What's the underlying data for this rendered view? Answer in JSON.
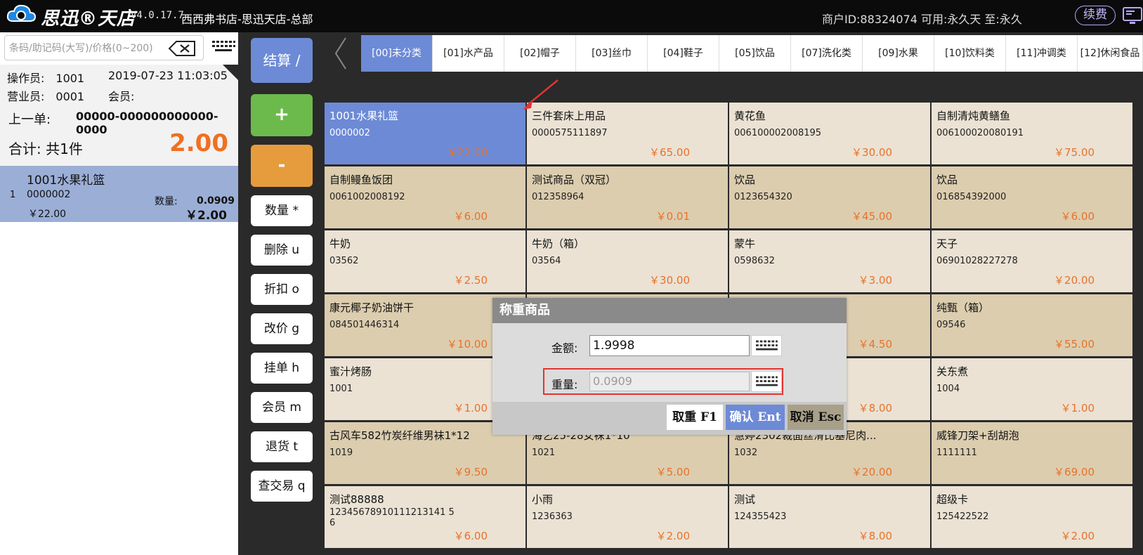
{
  "header": {
    "brand": "思迅®天店",
    "version": "V4.0.17.7",
    "store": "西西弗书店-思迅天店-总部",
    "merchant": "商户ID:88324074 可用:永久天 至:永久",
    "renew": "续费"
  },
  "search": {
    "placeholder": "条码/助记码(大写)/价格(0~200)"
  },
  "info": {
    "operator": "操作员:　1001",
    "datetime": "2019-07-23 11:03:05",
    "clerk": "营业员:　0001",
    "member": "会员:",
    "last_order_label": "上一单:",
    "last_order_value": "00000-000000000000-0000",
    "total_label": "合计: 共1件",
    "total_amount": "2.00"
  },
  "cart": {
    "items": [
      {
        "index": "1",
        "name": "1001水果礼篮",
        "code": "0000002",
        "unit_price": "￥22.00",
        "qty_label": "数量:",
        "qty": "0.0909",
        "subtotal": "￥2.00"
      }
    ]
  },
  "functions": {
    "checkout": "结算 /",
    "plus": "+",
    "minus": "-",
    "quantity": "数量 *",
    "delete": "删除 u",
    "discount": "折扣 o",
    "change_price": "改价 g",
    "hold": "挂单 h",
    "member": "会员 m",
    "return": "退货 t",
    "query": "查交易 q"
  },
  "categories": [
    {
      "label": "[00]未分类",
      "active": true
    },
    {
      "label": "[01]水产品",
      "active": false
    },
    {
      "label": "[02]帽子",
      "active": false
    },
    {
      "label": "[03]丝巾",
      "active": false
    },
    {
      "label": "[04]鞋子",
      "active": false
    },
    {
      "label": "[05]饮品",
      "active": false
    },
    {
      "label": "[07]洗化类",
      "active": false
    },
    {
      "label": "[09]水果",
      "active": false
    },
    {
      "label": "[10]饮料类",
      "active": false
    },
    {
      "label": "[11]冲调类",
      "active": false
    },
    {
      "label": "[12]休闲食品",
      "active": false
    }
  ],
  "products": [
    {
      "name": "1001水果礼篮",
      "code": "0000002",
      "price": "￥22.00",
      "bg": "#6d8ad6",
      "selected": true
    },
    {
      "name": "三件套床上用品",
      "code": "0000575111897",
      "price": "￥65.00",
      "bg": "#ebe2d4"
    },
    {
      "name": "黄花鱼",
      "code": "006100002008195",
      "price": "￥30.00",
      "bg": "#ebe2d4"
    },
    {
      "name": "自制清炖黄鳝鱼",
      "code": "006100020080191",
      "price": "￥75.00",
      "bg": "#ebe2d4"
    },
    {
      "name": "自制鳗鱼饭团",
      "code": "0061002008192",
      "price": "￥6.00",
      "bg": "#dccdaf"
    },
    {
      "name": "测试商品（双冠）",
      "code": "012358964",
      "price": "￥0.01",
      "bg": "#dccdaf"
    },
    {
      "name": "饮品",
      "code": "0123654320",
      "price": "￥45.00",
      "bg": "#dccdaf"
    },
    {
      "name": "饮品",
      "code": "016854392000",
      "price": "￥6.00",
      "bg": "#dccdaf"
    },
    {
      "name": "牛奶",
      "code": "03562",
      "price": "￥2.50",
      "bg": "#ebe2d4"
    },
    {
      "name": "牛奶（箱）",
      "code": "03564",
      "price": "￥30.00",
      "bg": "#ebe2d4"
    },
    {
      "name": "蒙牛",
      "code": "0598632",
      "price": "￥3.00",
      "bg": "#ebe2d4"
    },
    {
      "name": "天子",
      "code": "06901028227278",
      "price": "￥20.00",
      "bg": "#ebe2d4"
    },
    {
      "name": "康元椰子奶油饼干",
      "code": "084501446314",
      "price": "￥10.00",
      "bg": "#dccdaf"
    },
    {
      "name": "",
      "code": "",
      "price": "",
      "bg": "#dccdaf"
    },
    {
      "name": "",
      "code": "",
      "price": "￥4.50",
      "bg": "#dccdaf"
    },
    {
      "name": "纯甄（箱）",
      "code": "09546",
      "price": "￥55.00",
      "bg": "#dccdaf"
    },
    {
      "name": "蜜汁烤肠",
      "code": "1001",
      "price": "￥1.00",
      "bg": "#ebe2d4"
    },
    {
      "name": "",
      "code": "",
      "price": "",
      "bg": "#ebe2d4"
    },
    {
      "name": "",
      "code": "",
      "price": "￥8.00",
      "bg": "#ebe2d4"
    },
    {
      "name": "关东煮",
      "code": "1004",
      "price": "￥1.00",
      "bg": "#ebe2d4"
    },
    {
      "name": "古风车582竹炭纤维男袜1*12",
      "code": "1019",
      "price": "￥9.50",
      "bg": "#dccdaf"
    },
    {
      "name": "海艺25-28女袜1*10",
      "code": "1021",
      "price": "￥5.00",
      "bg": "#dccdaf"
    },
    {
      "name": "慧婷2302裁面丝滑比基尼肉...",
      "code": "1032",
      "price": "￥20.00",
      "bg": "#dccdaf"
    },
    {
      "name": "威锋刀架+刮胡泡",
      "code": "1111111",
      "price": "￥69.00",
      "bg": "#dccdaf"
    },
    {
      "name": "测试88888",
      "code": "12345678910111213141 5\n6",
      "price": "￥6.00",
      "bg": "#ebe2d4"
    },
    {
      "name": "小雨",
      "code": "1236363",
      "price": "￥2.00",
      "bg": "#ebe2d4"
    },
    {
      "name": "测试",
      "code": "124355423",
      "price": "￥8.00",
      "bg": "#ebe2d4"
    },
    {
      "name": "超级卡",
      "code": "125422522",
      "price": "￥2.00",
      "bg": "#ebe2d4"
    }
  ],
  "dialog": {
    "title": "称重商品",
    "amount_label": "金额:",
    "amount_value": "1.9998",
    "weight_label": "重量:",
    "weight_value": "0.0909",
    "btn_zero": "取重 F1",
    "btn_confirm": "确认 Ent",
    "btn_cancel": "取消 Esc"
  },
  "colors": {
    "accent": "#6d8ad6",
    "price": "#e8722a",
    "total": "#f07020",
    "plus": "#6cba4c",
    "minus": "#e69c3c",
    "highlight_frame": "#e53333"
  }
}
